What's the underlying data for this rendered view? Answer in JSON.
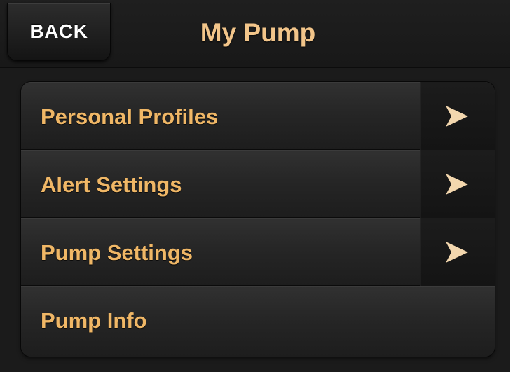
{
  "header": {
    "back_label": "BACK",
    "title": "My Pump"
  },
  "menu": {
    "items": [
      {
        "label": "Personal Profiles",
        "has_arrow": true,
        "arrow_icon": "chevron-right-icon"
      },
      {
        "label": "Alert Settings",
        "has_arrow": true,
        "arrow_icon": "chevron-right-icon"
      },
      {
        "label": "Pump Settings",
        "has_arrow": true,
        "arrow_icon": "chevron-right-icon"
      },
      {
        "label": "Pump Info",
        "has_arrow": false
      }
    ]
  },
  "colors": {
    "background": "#1b1b1b",
    "title": "#f2c58a",
    "item_label": "#f0b766",
    "arrow": "#f3d7ae"
  }
}
